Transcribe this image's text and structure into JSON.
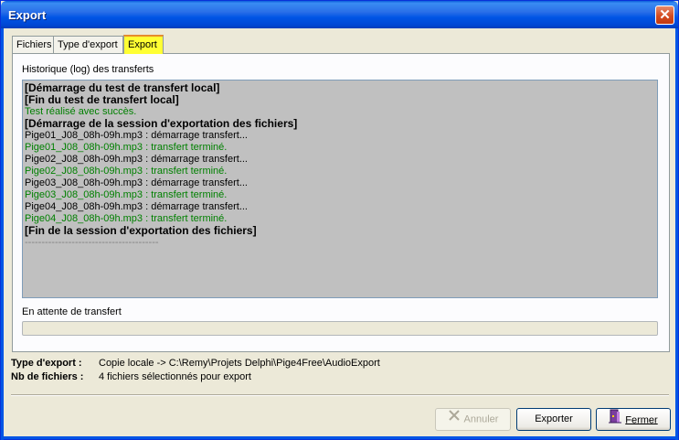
{
  "window": {
    "title": "Export"
  },
  "tabs": [
    {
      "label": "Fichiers"
    },
    {
      "label": "Type d'export"
    },
    {
      "label": "Export"
    }
  ],
  "log": {
    "label": "Historique (log) des transferts",
    "lines": [
      {
        "text": "[Démarrage du test de transfert local]",
        "style": "bold"
      },
      {
        "text": "[Fin du test de transfert local]",
        "style": "bold"
      },
      {
        "text": "Test réalisé avec succès.",
        "style": "green"
      },
      {
        "text": "[Démarrage de la session d'exportation des fichiers]",
        "style": "bold"
      },
      {
        "text": "Pige01_J08_08h-09h.mp3 : démarrage transfert...",
        "style": "normal"
      },
      {
        "text": "Pige01_J08_08h-09h.mp3 : transfert terminé.",
        "style": "green"
      },
      {
        "text": "Pige02_J08_08h-09h.mp3 : démarrage transfert...",
        "style": "normal"
      },
      {
        "text": "Pige02_J08_08h-09h.mp3 : transfert terminé.",
        "style": "green"
      },
      {
        "text": "Pige03_J08_08h-09h.mp3 : démarrage transfert...",
        "style": "normal"
      },
      {
        "text": "Pige03_J08_08h-09h.mp3 : transfert terminé.",
        "style": "green"
      },
      {
        "text": "Pige04_J08_08h-09h.mp3 : démarrage transfert...",
        "style": "normal"
      },
      {
        "text": "Pige04_J08_08h-09h.mp3 : transfert terminé.",
        "style": "green"
      },
      {
        "text": "[Fin de la session d'exportation des fichiers]",
        "style": "bold"
      },
      {
        "text": "----------------------------------------",
        "style": "sep"
      }
    ]
  },
  "status": {
    "text": "En attente de transfert",
    "progress": 0
  },
  "info": {
    "type_label": "Type d'export :",
    "type_value": "Copie locale  ->  C:\\Remy\\Projets Delphi\\Pige4Free\\AudioExport",
    "count_label": "Nb de fichiers :",
    "count_value": "4 fichiers sélectionnés pour export"
  },
  "buttons": {
    "cancel": "Annuler",
    "export": "Exporter",
    "close": "Fermer"
  },
  "colors": {
    "log_background": "#C0C0C0",
    "log_success": "#008000",
    "active_tab": "#FFFF33"
  }
}
